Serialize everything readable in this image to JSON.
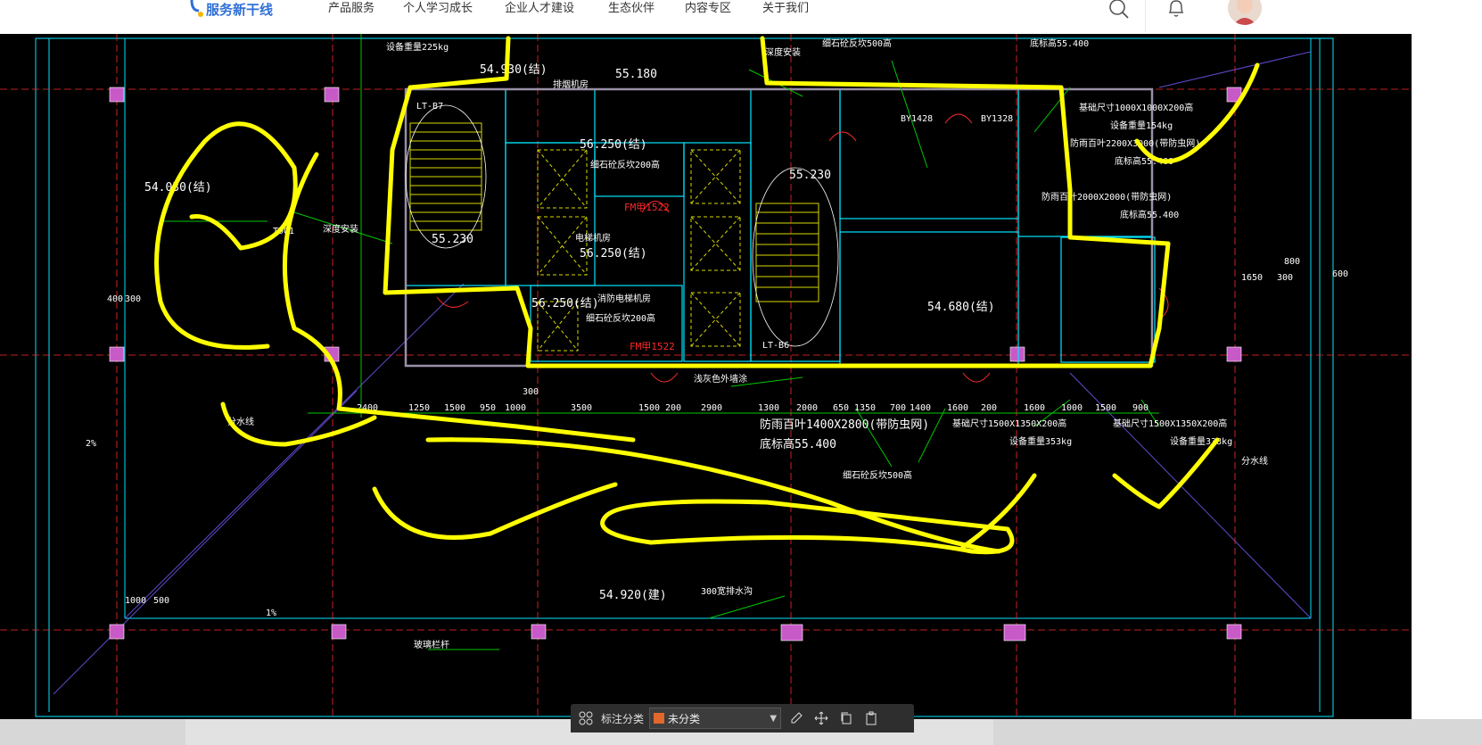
{
  "nav": {
    "logo_text": "服务新干线",
    "items": [
      "产品服务",
      "个人学习成长",
      "企业人才建设",
      "生态伙伴",
      "内容专区",
      "关于我们"
    ]
  },
  "colors": {
    "brand": "#2f6fd6",
    "cad_background": "#000000",
    "markup_yellow": "#ffff00",
    "cad_cyan": "#00e5ff",
    "cad_green": "#00c800",
    "cad_red": "#ff2a2a",
    "cad_magenta": "#c85ac8"
  },
  "icons": {
    "search": "search-icon",
    "bell": "bell-icon",
    "avatar": "user-avatar"
  },
  "drawing": {
    "texts": [
      "设备重量225kg",
      "54.930(结)",
      "55.180",
      "排烟机房",
      "LT-B7",
      "56.250(结)",
      "细石砼反坎200高",
      "FM甲1522",
      "深度安装",
      "细石砼反坎500高",
      "底标高55.400",
      "基础尺寸1000X1000X200高",
      "设备重量154kg",
      "防雨百叶2200X3000(带防虫网)",
      "底标高55.400",
      "防雨百叶2000X2000(带防虫网)",
      "底标高55.400",
      "BY1428",
      "BY1328",
      "55.230",
      "LT-B6",
      "54.680(结)",
      "54.030(结)",
      "TD01",
      "深度安装",
      "55.230",
      "56.250(结)",
      "电梯机房",
      "消防电梯机房",
      "56.250(结)",
      "细石砼反坎200高",
      "FM甲1522",
      "浅灰色外墙涂",
      "防雨百叶1400X2800(带防虫网)",
      "底标高55.400",
      "基础尺寸1500X1350X200高",
      "设备重量353kg",
      "基础尺寸1500X1350X200高",
      "设备重量338kg",
      "细石砼反坎500高",
      "分水线",
      "分水线",
      "54.920(建)",
      "300宽排水沟",
      "玻璃栏杆",
      "2%",
      "1%"
    ],
    "dimensions": [
      "2400",
      "1250",
      "1500",
      "950",
      "1000",
      "3500",
      "1500",
      "200",
      "2900",
      "1300",
      "2000",
      "650",
      "1350",
      "700",
      "1400",
      "1600",
      "200",
      "1600",
      "1000",
      "1500",
      "900",
      "300",
      "1000",
      "500",
      "400",
      "300",
      "1650",
      "300",
      "800",
      "600"
    ]
  },
  "annotation_toolbar": {
    "label": "标注分类",
    "selected_category": "未分类",
    "category_color": "#e2672a"
  }
}
